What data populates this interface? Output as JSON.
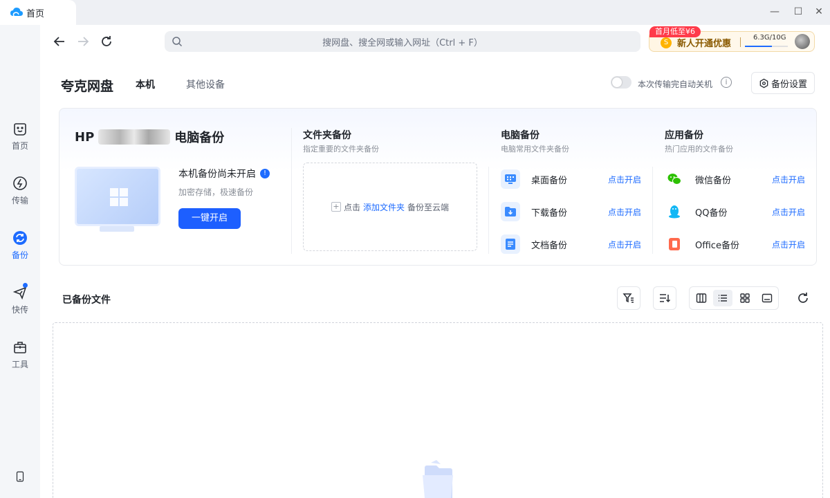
{
  "titlebar": {
    "tab_label": "首页",
    "minimize": "—",
    "maximize": "☐",
    "close": "✕"
  },
  "toolbar": {
    "search_placeholder": "搜网盘、搜全网或输入网址（Ctrl + F）",
    "promo_badge": "首月低至¥6",
    "promo_coin": "S",
    "promo_text": "新人开通优惠",
    "storage_text": "6.3G/10G",
    "storage_used_fraction": 0.63
  },
  "sidebar": {
    "items": [
      {
        "label": "首页",
        "icon": "smile-icon"
      },
      {
        "label": "传输",
        "icon": "transfer-icon"
      },
      {
        "label": "备份",
        "icon": "backup-icon",
        "active": true
      },
      {
        "label": "快传",
        "icon": "send-icon",
        "badge": true
      },
      {
        "label": "工具",
        "icon": "toolbox-icon"
      }
    ],
    "bottom_icon": "phone-icon"
  },
  "header": {
    "brand": "夸克网盘",
    "tabs": [
      "本机",
      "其他设备"
    ],
    "auto_shutdown": "本次传输完自动关机",
    "auto_shutdown_on": false,
    "backup_settings": "备份设置"
  },
  "pc_backup": {
    "title_prefix": "HP",
    "title_suffix": "电脑备份",
    "status_title": "本机备份尚未开启",
    "status_sub": "加密存储，极速备份",
    "enable_button": "一键开启"
  },
  "folder_backup": {
    "title": "文件夹备份",
    "subtitle": "指定重要的文件夹备份",
    "drop_prefix": "点击",
    "drop_link": "添加文件夹",
    "drop_suffix": "备份至云端"
  },
  "computer_backup": {
    "title": "电脑备份",
    "subtitle": "电脑常用文件夹备份",
    "items": [
      {
        "label": "桌面备份",
        "action": "点击开启"
      },
      {
        "label": "下载备份",
        "action": "点击开启"
      },
      {
        "label": "文档备份",
        "action": "点击开启"
      }
    ]
  },
  "app_backup": {
    "title": "应用备份",
    "subtitle": "热门应用的文件备份",
    "items": [
      {
        "label": "微信备份",
        "action": "点击开启"
      },
      {
        "label": "QQ备份",
        "action": "点击开启"
      },
      {
        "label": "Office备份",
        "action": "点击开启"
      }
    ]
  },
  "files": {
    "title": "已备份文件"
  },
  "colors": {
    "accent": "#1d6bff",
    "button": "#1d5fff",
    "promo_badge": "#ff3b4a",
    "wechat": "#2dc100",
    "qq": "#12b7f5",
    "office": "#ff6a4d"
  }
}
